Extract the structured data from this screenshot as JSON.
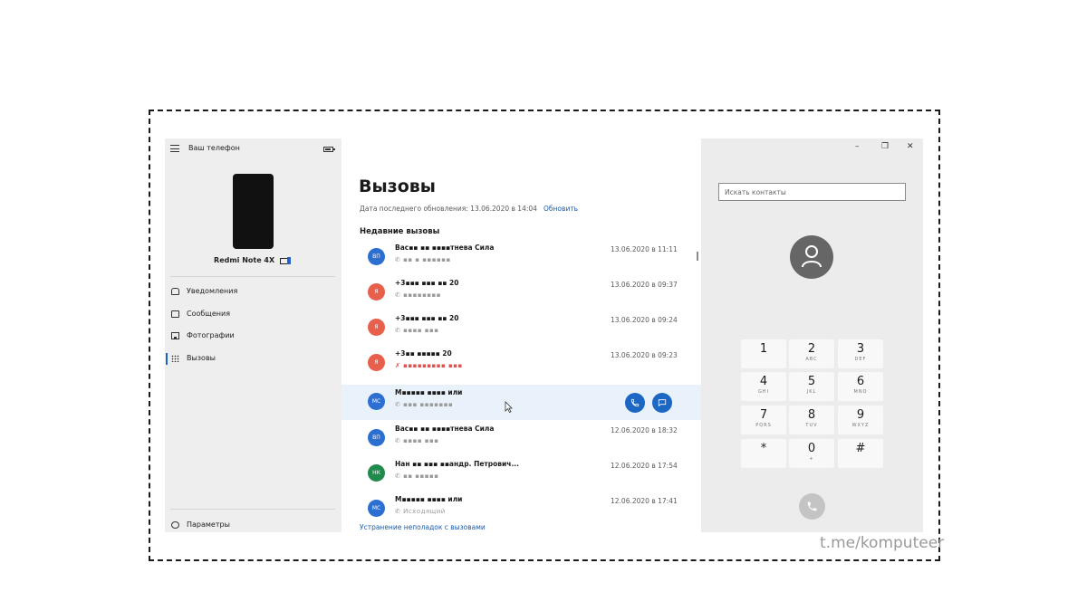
{
  "sidebar": {
    "title": "Ваш телефон",
    "device_name": "Redmi Note 4X",
    "nav": [
      {
        "label": "Уведомления",
        "icon": "bell-icon"
      },
      {
        "label": "Сообщения",
        "icon": "message-icon"
      },
      {
        "label": "Фотографии",
        "icon": "photo-icon"
      },
      {
        "label": "Вызовы",
        "icon": "dialpad-icon"
      }
    ],
    "settings_label": "Параметры",
    "active_item": "Вызовы"
  },
  "main": {
    "title": "Вызовы",
    "last_update": "Дата последнего обновления: 13.06.2020 в 14:04",
    "refresh_label": "Обновить",
    "section_title": "Недавние вызовы",
    "calls": [
      {
        "initials": "ВП",
        "color": "#2d6fd1",
        "name": "Вас▪▪ ▪▪ ▪▪▪▪тнева Сила",
        "sub": "✆ ▪▪ ▪ ▪▪▪▪▪▪",
        "date": "13.06.2020 в 11:11",
        "missed": false
      },
      {
        "initials": "Я",
        "color": "#e8604c",
        "name": "+3▪▪▪ ▪▪▪ ▪▪ 20",
        "sub": "✆ ▪▪▪▪▪▪▪▪",
        "date": "13.06.2020 в 09:37",
        "missed": false
      },
      {
        "initials": "Я",
        "color": "#e8604c",
        "name": "+3▪▪▪ ▪▪▪ ▪▪ 20",
        "sub": "✆ ▪▪▪▪ ▪▪▪",
        "date": "13.06.2020 в 09:24",
        "missed": false
      },
      {
        "initials": "Я",
        "color": "#e8604c",
        "name": "+3▪▪ ▪▪▪▪▪ 20",
        "sub": "✗ ▪▪▪▪▪▪▪▪▪ ▪▪▪",
        "date": "13.06.2020 в 09:23",
        "missed": true
      },
      {
        "initials": "МС",
        "color": "#2d6fd1",
        "name": "М▪▪▪▪▪ ▪▪▪▪ или",
        "sub": "✆ ▪▪▪ ▪▪▪▪▪▪▪",
        "date": "",
        "missed": false
      },
      {
        "initials": "ВП",
        "color": "#2d6fd1",
        "name": "Вас▪▪ ▪▪ ▪▪▪▪тнева Сила",
        "sub": "✆ ▪▪▪▪ ▪▪▪",
        "date": "12.06.2020 в 18:32",
        "missed": false
      },
      {
        "initials": "НК",
        "color": "#1f8a4c",
        "name": "Нан ▪▪ ▪▪▪ ▪▪андр. Петрович...",
        "sub": "✆ ▪▪ ▪▪▪▪▪",
        "date": "12.06.2020 в 17:54",
        "missed": false
      },
      {
        "initials": "МС",
        "color": "#2d6fd1",
        "name": "М▪▪▪▪▪ ▪▪▪▪ или",
        "sub": "✆ Исходящий",
        "date": "12.06.2020 в 17:41",
        "missed": false
      }
    ],
    "troubleshoot": "Устранение неполадок с вызовами"
  },
  "dialer": {
    "window_controls": [
      "–",
      "❐",
      "✕"
    ],
    "search_placeholder": "Искать контакты",
    "keys": [
      {
        "digit": "1",
        "letters": ""
      },
      {
        "digit": "2",
        "letters": "ABC"
      },
      {
        "digit": "3",
        "letters": "DEF"
      },
      {
        "digit": "4",
        "letters": "GHI"
      },
      {
        "digit": "5",
        "letters": "JKL"
      },
      {
        "digit": "6",
        "letters": "MNO"
      },
      {
        "digit": "7",
        "letters": "PQRS"
      },
      {
        "digit": "8",
        "letters": "TUV"
      },
      {
        "digit": "9",
        "letters": "WXYZ"
      },
      {
        "digit": "*",
        "letters": ""
      },
      {
        "digit": "0",
        "letters": "+"
      },
      {
        "digit": "#",
        "letters": ""
      }
    ]
  },
  "watermark": "t.me/komputeer"
}
